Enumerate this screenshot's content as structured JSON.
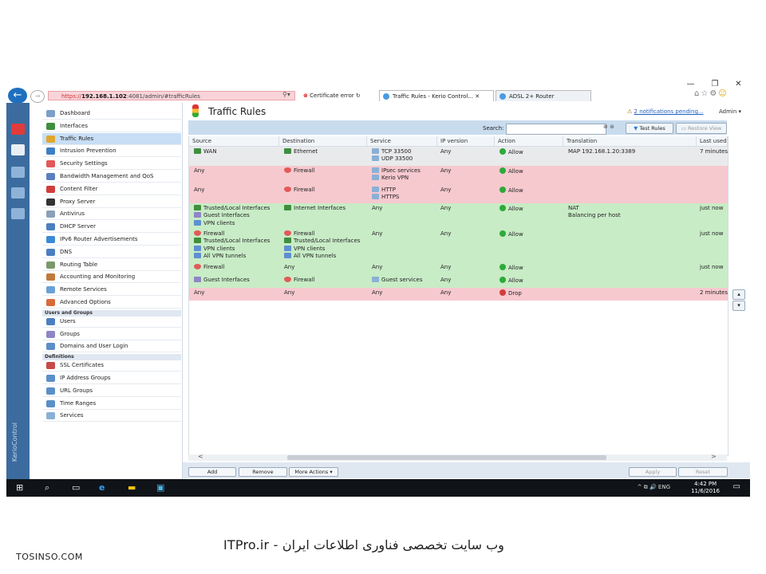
{
  "browser": {
    "url_scheme": "https://",
    "url_host": "192.168.1.102",
    "url_rest": ":4081/admin/#trafficRules",
    "cert_error": "Certificate error",
    "tabs": [
      {
        "label": "Traffic Rules - Kerio Control..."
      },
      {
        "label": "ADSL 2+ Router"
      }
    ],
    "window_controls": [
      "—",
      "❐",
      "✕"
    ]
  },
  "strip": {
    "brand": "KerioControl"
  },
  "sidebar": {
    "items": [
      {
        "label": "Dashboard",
        "icon": "dashboard-icon",
        "color": "#7aa0c8"
      },
      {
        "label": "Interfaces",
        "icon": "interfaces-icon",
        "color": "#3f8f3f"
      },
      {
        "label": "Traffic Rules",
        "icon": "traffic-light-icon",
        "color": "#e1a72c",
        "selected": true
      },
      {
        "label": "Intrusion Prevention",
        "icon": "shield-icon",
        "color": "#3b7fc4"
      },
      {
        "label": "Security Settings",
        "icon": "security-icon",
        "color": "#e35959"
      },
      {
        "label": "Bandwidth Management and QoS",
        "icon": "bandwidth-icon",
        "color": "#5a7fc0"
      },
      {
        "label": "Content Filter",
        "icon": "filter-icon",
        "color": "#d23c3c"
      },
      {
        "label": "Proxy Server",
        "icon": "proxy-icon",
        "color": "#333333"
      },
      {
        "label": "Antivirus",
        "icon": "antivirus-icon",
        "color": "#8aa0b8"
      },
      {
        "label": "DHCP Server",
        "icon": "dhcp-icon",
        "color": "#4a7fc0"
      },
      {
        "label": "IPv6 Router Advertisements",
        "icon": "ipv6-icon",
        "color": "#3b8ad6"
      },
      {
        "label": "DNS",
        "icon": "dns-icon",
        "color": "#4a7fc0"
      },
      {
        "label": "Routing Table",
        "icon": "routing-icon",
        "color": "#7a9a6a"
      },
      {
        "label": "Accounting and Monitoring",
        "icon": "accounting-icon",
        "color": "#c07a3a"
      },
      {
        "label": "Remote Services",
        "icon": "cloud-icon",
        "color": "#6aa0d8"
      },
      {
        "label": "Advanced Options",
        "icon": "advanced-icon",
        "color": "#d86a3a"
      }
    ],
    "section_users": "Users and Groups",
    "users_items": [
      {
        "label": "Users",
        "icon": "user-icon",
        "color": "#4a7fc0"
      },
      {
        "label": "Groups",
        "icon": "group-icon",
        "color": "#8e86c7"
      },
      {
        "label": "Domains and User Login",
        "icon": "domain-icon",
        "color": "#5a8fc8"
      }
    ],
    "section_defs": "Definitions",
    "defs_items": [
      {
        "label": "SSL Certificates",
        "icon": "certificate-icon",
        "color": "#c84a4a"
      },
      {
        "label": "IP Address Groups",
        "icon": "ip-group-icon",
        "color": "#5a8fc8"
      },
      {
        "label": "URL Groups",
        "icon": "url-group-icon",
        "color": "#5a8fc8"
      },
      {
        "label": "Time Ranges",
        "icon": "time-icon",
        "color": "#5a8fc8"
      },
      {
        "label": "Services",
        "icon": "services-icon",
        "color": "#8ab0d6"
      }
    ]
  },
  "header": {
    "title": "Traffic Rules",
    "notifications": "2 notifications pending...",
    "user": "Admin ▾"
  },
  "toolbar": {
    "search_label": "Search:",
    "search_value": "",
    "test_rules": "Test Rules",
    "restore_view": "Restore View"
  },
  "table": {
    "columns": [
      "Source",
      "Destination",
      "Service",
      "IP version",
      "Action",
      "Translation",
      "Last used"
    ],
    "rows": [
      {
        "style": "grey",
        "source": [
          {
            "t": "WAN",
            "i": "net"
          }
        ],
        "destination": [
          {
            "t": "Ethernet",
            "i": "net"
          }
        ],
        "service": [
          {
            "t": "TCP 33500",
            "i": "svc"
          },
          {
            "t": "UDP 33500",
            "i": "svc"
          }
        ],
        "ipversion": "Any",
        "action": {
          "t": "Allow",
          "i": "allow"
        },
        "translation": [
          "MAP 192.168.1.20:3389"
        ],
        "lastused": "7 minutes"
      },
      {
        "style": "red",
        "source": [
          {
            "t": "Any",
            "i": ""
          }
        ],
        "destination": [
          {
            "t": "Firewall",
            "i": "fw"
          }
        ],
        "service": [
          {
            "t": "IPsec services",
            "i": "svc"
          },
          {
            "t": "Kerio VPN",
            "i": "svc"
          }
        ],
        "ipversion": "Any",
        "action": {
          "t": "Allow",
          "i": "allow"
        },
        "translation": [],
        "lastused": ""
      },
      {
        "style": "red",
        "source": [
          {
            "t": "Any",
            "i": ""
          }
        ],
        "destination": [
          {
            "t": "Firewall",
            "i": "fw"
          }
        ],
        "service": [
          {
            "t": "HTTP",
            "i": "svc"
          },
          {
            "t": "HTTPS",
            "i": "svc"
          }
        ],
        "ipversion": "Any",
        "action": {
          "t": "Allow",
          "i": "allow"
        },
        "translation": [],
        "lastused": ""
      },
      {
        "style": "green",
        "source": [
          {
            "t": "Trusted/Local Interfaces",
            "i": "net"
          },
          {
            "t": "Guest Interfaces",
            "i": "grp"
          },
          {
            "t": "VPN clients",
            "i": "vpn"
          }
        ],
        "destination": [
          {
            "t": "Internet Interfaces",
            "i": "net"
          }
        ],
        "service": [
          {
            "t": "Any",
            "i": ""
          }
        ],
        "ipversion": "Any",
        "action": {
          "t": "Allow",
          "i": "allow"
        },
        "translation": [
          "NAT",
          "Balancing per host"
        ],
        "lastused": "just now"
      },
      {
        "style": "green",
        "source": [
          {
            "t": "Firewall",
            "i": "fw"
          },
          {
            "t": "Trusted/Local Interfaces",
            "i": "net"
          },
          {
            "t": "VPN clients",
            "i": "vpn"
          },
          {
            "t": "All VPN tunnels",
            "i": "vpn"
          }
        ],
        "destination": [
          {
            "t": "Firewall",
            "i": "fw"
          },
          {
            "t": "Trusted/Local Interfaces",
            "i": "net"
          },
          {
            "t": "VPN clients",
            "i": "vpn"
          },
          {
            "t": "All VPN tunnels",
            "i": "vpn"
          }
        ],
        "service": [
          {
            "t": "Any",
            "i": ""
          }
        ],
        "ipversion": "Any",
        "action": {
          "t": "Allow",
          "i": "allow"
        },
        "translation": [],
        "lastused": "just now"
      },
      {
        "style": "green",
        "source": [
          {
            "t": "Firewall",
            "i": "fw"
          }
        ],
        "destination": [
          {
            "t": "Any",
            "i": ""
          }
        ],
        "service": [
          {
            "t": "Any",
            "i": ""
          }
        ],
        "ipversion": "Any",
        "action": {
          "t": "Allow",
          "i": "allow"
        },
        "translation": [],
        "lastused": "just now"
      },
      {
        "style": "green",
        "source": [
          {
            "t": "Guest Interfaces",
            "i": "grp"
          }
        ],
        "destination": [
          {
            "t": "Firewall",
            "i": "fw"
          }
        ],
        "service": [
          {
            "t": "Guest services",
            "i": "svc"
          }
        ],
        "ipversion": "Any",
        "action": {
          "t": "Allow",
          "i": "allow"
        },
        "translation": [],
        "lastused": ""
      },
      {
        "style": "red",
        "source": [
          {
            "t": "Any",
            "i": ""
          }
        ],
        "destination": [
          {
            "t": "Any",
            "i": ""
          }
        ],
        "service": [
          {
            "t": "Any",
            "i": ""
          }
        ],
        "ipversion": "Any",
        "action": {
          "t": "Drop",
          "i": "drop"
        },
        "translation": [],
        "lastused": "2 minutes"
      }
    ]
  },
  "bottom": {
    "add": "Add",
    "remove": "Remove",
    "more": "More Actions ▾",
    "apply": "Apply",
    "reset": "Reset"
  },
  "taskbar": {
    "tray": "^  ⧉  🔊  ENG",
    "time": "4:42 PM",
    "date": "11/6/2016"
  },
  "footer": {
    "persian": "ITPro.ir - وب سایت تخصصی فناوری اطلاعات ایران",
    "site": "TOSINSO.COM"
  }
}
